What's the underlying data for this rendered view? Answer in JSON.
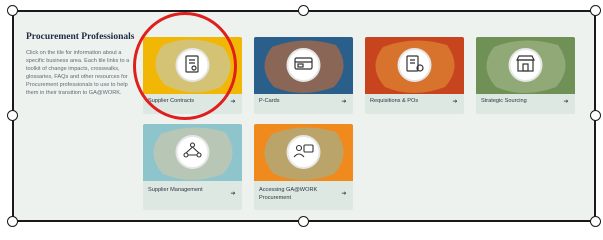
{
  "intro": {
    "title": "Procurement Professionals",
    "description": "Click on the tile for information about a specific business area. Each tile links to a toolkit of change impacts, crosswalks, glossaries, FAQs and other resources for Procurement professionals to use to help them in their transition to GA@WORK."
  },
  "tiles": [
    {
      "label": "Supplier Contracts",
      "icon": "contract-icon",
      "color": "#f2b705"
    },
    {
      "label": "P-Cards",
      "icon": "credit-card-icon",
      "color": "#2a5f8c"
    },
    {
      "label": "Requisitions & POs",
      "icon": "requisition-document-icon",
      "color": "#c8441e"
    },
    {
      "label": "Strategic Sourcing",
      "icon": "storefront-icon",
      "color": "#6f9156"
    },
    {
      "label": "Supplier Management",
      "icon": "network-people-icon",
      "color": "#8ec4cc"
    },
    {
      "label": "Accessing GA@WORK Procurement",
      "icon": "user-login-icon",
      "color": "#f08a1d"
    }
  ],
  "arrow_glyph": "➔",
  "annotation": {
    "type": "red-circle",
    "target": "Supplier Contracts",
    "color": "#e01e1e"
  }
}
